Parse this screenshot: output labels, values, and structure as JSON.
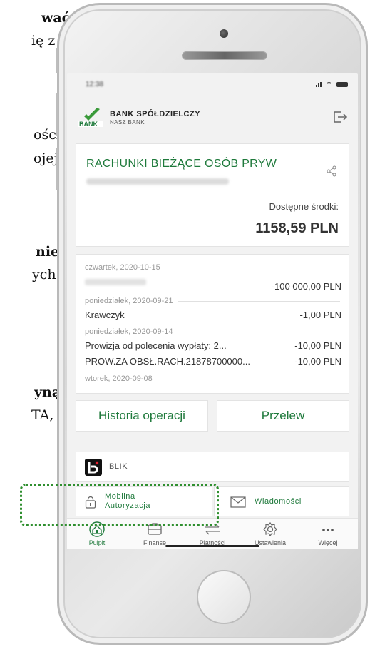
{
  "background_text": {
    "lines": [
      {
        "text": "wać,",
        "bold": true
      },
      {
        "text": "ię z",
        "bold": false
      },
      {
        "text": "ości",
        "bold": false
      },
      {
        "text": "ojej",
        "bold": false
      },
      {
        "text": "nie",
        "bold": true
      },
      {
        "text": "ych",
        "bold": false
      },
      {
        "text": "yną",
        "bold": true
      },
      {
        "text": "TA,",
        "bold": false
      }
    ]
  },
  "status_bar": {
    "time": "12:38"
  },
  "header": {
    "bank_name": "BANK SPÓŁDZIELCZY",
    "bank_subtitle": "NASZ BANK",
    "logout_icon": "logout-icon"
  },
  "account": {
    "name": "RACHUNKI BIEŻĄCE OSÓB PRYW",
    "available_label": "Dostępne środki:",
    "available_amount": "1158,59 PLN"
  },
  "transactions": {
    "groups": [
      {
        "date": "czwartek, 2020-10-15",
        "items": [
          {
            "title": "",
            "amount": "-100 000,00 PLN"
          }
        ]
      },
      {
        "date": "poniedziałek, 2020-09-21",
        "items": [
          {
            "title": "Krawczyk",
            "amount": "-1,00 PLN"
          }
        ]
      },
      {
        "date": "poniedziałek, 2020-09-14",
        "items": [
          {
            "title": "Prowizja od polecenia wypłaty: 2...",
            "amount": "-10,00 PLN"
          },
          {
            "title": "PROW.ZA OBSŁ.RACH.21878700000...",
            "amount": "-10,00 PLN"
          }
        ]
      },
      {
        "date": "wtorek, 2020-09-08",
        "items": []
      }
    ]
  },
  "buttons": {
    "history": "Historia operacji",
    "transfer": "Przelew"
  },
  "blik": {
    "label": "BLIK"
  },
  "quick_actions": {
    "mobile_auth_line1": "Mobilna",
    "mobile_auth_line2": "Autoryzacja",
    "messages": "Wiadomości"
  },
  "tabbar": {
    "tabs": [
      {
        "label": "Pulpit",
        "icon": "home-icon"
      },
      {
        "label": "Finanse",
        "icon": "wallet-icon"
      },
      {
        "label": "Płatności",
        "icon": "transfer-arrows-icon"
      },
      {
        "label": "Ustawienia",
        "icon": "gear-icon"
      },
      {
        "label": "Więcej",
        "icon": "more-dots-icon"
      }
    ]
  },
  "colors": {
    "brand_green": "#1f7a3c",
    "highlight": "#2f8f2f"
  }
}
